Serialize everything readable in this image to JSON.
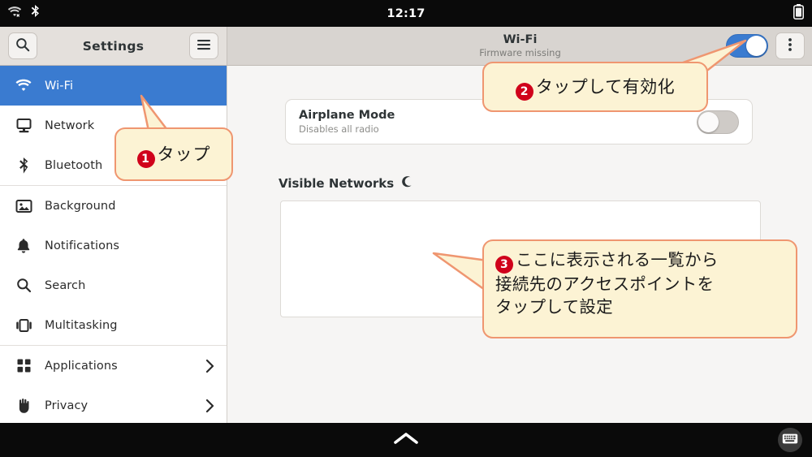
{
  "statusbar": {
    "clock": "12:17",
    "left_icons": [
      "wifi-disconnected-icon",
      "bluetooth-icon"
    ],
    "right_icons": [
      "battery-icon"
    ]
  },
  "headerbar": {
    "search_icon": "search-icon",
    "app_title": "Settings",
    "menu_icon": "hamburger-menu-icon",
    "page_title": "Wi-Fi",
    "page_subtitle": "Firmware missing",
    "wifi_toggle": {
      "state": "on",
      "color": "#3a7bd0"
    },
    "overflow_icon": "three-dots-vertical-icon"
  },
  "sidebar": {
    "items": [
      {
        "label": "Wi-Fi",
        "icon": "wifi-icon",
        "selected": true,
        "chevron": false
      },
      {
        "label": "Network",
        "icon": "network-monitor-icon",
        "selected": false,
        "chevron": false
      },
      {
        "label": "Bluetooth",
        "icon": "bluetooth-icon",
        "selected": false,
        "chevron": false
      },
      {
        "label": "Background",
        "icon": "picture-icon",
        "selected": false,
        "chevron": false
      },
      {
        "label": "Notifications",
        "icon": "bell-icon",
        "selected": false,
        "chevron": false
      },
      {
        "label": "Search",
        "icon": "search-icon",
        "selected": false,
        "chevron": false
      },
      {
        "label": "Multitasking",
        "icon": "multitasking-icon",
        "selected": false,
        "chevron": false
      },
      {
        "label": "Applications",
        "icon": "grid-apps-icon",
        "selected": false,
        "chevron": true
      },
      {
        "label": "Privacy",
        "icon": "hand-icon",
        "selected": false,
        "chevron": true
      }
    ]
  },
  "content": {
    "airplane": {
      "title": "Airplane Mode",
      "subtitle": "Disables all radio",
      "toggle_state": "off"
    },
    "networks": {
      "heading": "Visible Networks",
      "spinner_icon": "loading-spinner-icon",
      "items": []
    }
  },
  "bottombar": {
    "up_icon": "chevron-up-icon",
    "keyboard_icon": "keyboard-icon"
  },
  "callouts": [
    {
      "number": "❶",
      "text": "タップ"
    },
    {
      "number": "❷",
      "text": "タップして有効化"
    },
    {
      "number": "❸",
      "line1": "ここに表示される一覧から",
      "line2": "接続先のアクセスポイントを",
      "line3": "タップして設定"
    }
  ],
  "colors": {
    "accent": "#3a7bd0",
    "callout_fill": "#fcf3d4",
    "callout_border": "#ef9670",
    "badge": "#d0021b"
  }
}
